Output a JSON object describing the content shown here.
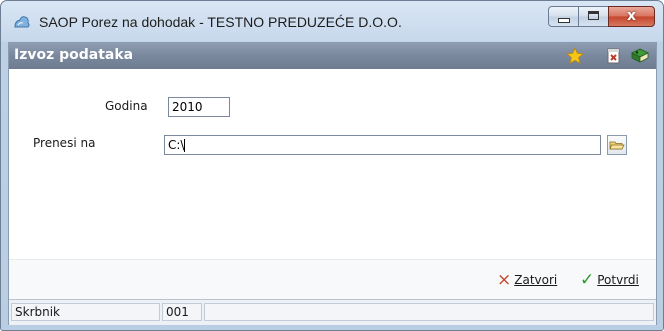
{
  "window": {
    "title": "SAOP Porez na dohodak - TESTNO PREDUZEĆE D.O.O.",
    "close_glyph": "x"
  },
  "header": {
    "title": "Izvoz podataka",
    "icons": [
      "star-icon",
      "document-delete-icon",
      "book-icon"
    ]
  },
  "form": {
    "year_label": "Godina",
    "year_value": "2010",
    "target_label": "Prenesi na",
    "target_value": "C:\\"
  },
  "actions": {
    "close_label": "Zatvori",
    "close_icon": "×",
    "confirm_label": "Potvrdi",
    "confirm_icon": "✓"
  },
  "status": {
    "user": "Skrbnik",
    "code": "001",
    "extra": ""
  },
  "colors": {
    "header_bg": "#7a889e",
    "close_red": "#c4452b",
    "confirm_green": "#2e9a2e"
  }
}
